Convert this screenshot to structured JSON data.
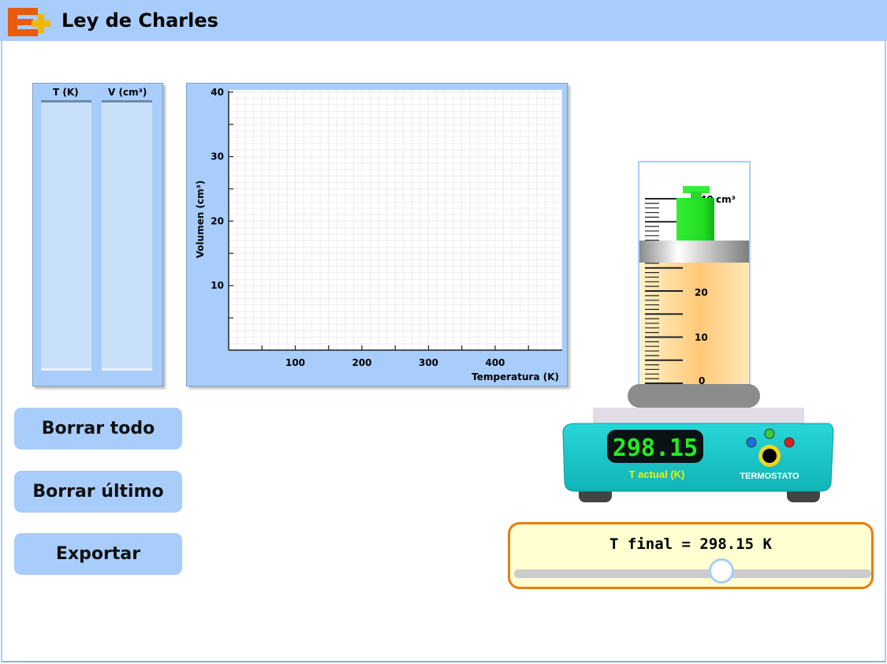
{
  "app": {
    "title": "Ley de Charles",
    "logo_icon": "e-plus-logo-icon"
  },
  "table": {
    "headers": [
      "T  (K)",
      "V  (cm³)"
    ],
    "rows": []
  },
  "chart_data": {
    "type": "scatter",
    "xlabel": "Temperatura (K)",
    "ylabel": "Volumen (cm³)",
    "xlim": [
      0,
      500
    ],
    "ylim": [
      0,
      40
    ],
    "x_tick_labels": [
      "100",
      "200",
      "300",
      "400"
    ],
    "y_tick_labels": [
      "10",
      "20",
      "30",
      "40"
    ],
    "grid": true,
    "series": []
  },
  "buttons": {
    "clear_all": "Borrar todo",
    "clear_last": "Borrar último",
    "export": "Exportar"
  },
  "cylinder": {
    "unit": "cm³",
    "scale_labels": [
      "40",
      "30",
      "20",
      "10",
      "0"
    ],
    "current_volume": 30,
    "max_volume": 40
  },
  "heater": {
    "display_value": "298.15",
    "display_label": "T actual (K)",
    "thermostat_label": "TERMOSTATO",
    "indicator_colors": [
      "#1f6fe0",
      "#3ccb3c",
      "#d82020"
    ]
  },
  "slider": {
    "label": "T final = 298.15 K",
    "value": 298.15,
    "fraction": 0.58
  },
  "colors": {
    "accent": "#a8cdfb",
    "slider_border": "#f07a12",
    "heater_body": "#19c5c8",
    "weight": "#33ee33"
  }
}
